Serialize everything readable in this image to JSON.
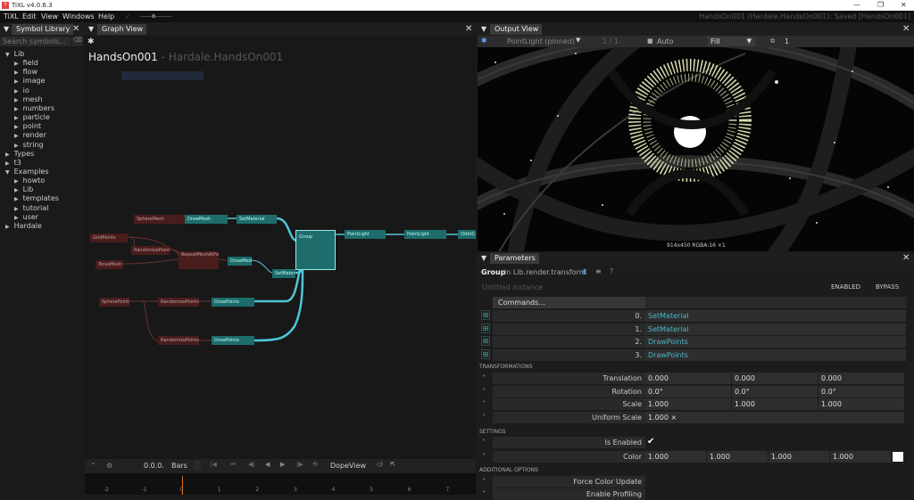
{
  "window": {
    "title": "TiXL v4.0.6.3",
    "logo": "T",
    "min": "—",
    "max": "❐",
    "close": "✕"
  },
  "menu": {
    "items": [
      "TiXL",
      "Edit",
      "View",
      "Windows",
      "Help"
    ],
    "status": "HandsOn001 (Hardale.HandsOn001): Saved [HandsOn001]"
  },
  "symbol_library": {
    "tab": "Symbol Library",
    "search_placeholder": "Search symbols...",
    "tree": [
      {
        "label": "Lib",
        "level": 0,
        "open": true
      },
      {
        "label": "field",
        "level": 1
      },
      {
        "label": "flow",
        "level": 1
      },
      {
        "label": "image",
        "level": 1
      },
      {
        "label": "io",
        "level": 1
      },
      {
        "label": "mesh",
        "level": 1
      },
      {
        "label": "numbers",
        "level": 1
      },
      {
        "label": "particle",
        "level": 1
      },
      {
        "label": "point",
        "level": 1
      },
      {
        "label": "render",
        "level": 1
      },
      {
        "label": "string",
        "level": 1
      },
      {
        "label": "Types",
        "level": 0
      },
      {
        "label": "t3",
        "level": 0
      },
      {
        "label": "Examples",
        "level": 0,
        "open": true
      },
      {
        "label": "howto",
        "level": 1
      },
      {
        "label": "Lib",
        "level": 1
      },
      {
        "label": "templates",
        "level": 1
      },
      {
        "label": "tutorial",
        "level": 1
      },
      {
        "label": "user",
        "level": 1
      },
      {
        "label": "Hardale",
        "level": 0
      }
    ]
  },
  "graph": {
    "tab": "Graph View",
    "title": "HandsOn001",
    "subtitle": " - Hardale.HandsOn001",
    "nodes": {
      "spheremesh": "SphereMesh",
      "drawmesh": "DrawMesh",
      "setmaterial1": "SetMaterial",
      "gridpoints": "GridPoints",
      "randomizepoints": "RandomizePoints",
      "repeatmesh": "RepeatMeshAtPoints",
      "torusmesh": "TorusMesh",
      "drawmesh2": "DrawMesh",
      "setmaterial2": "SetMaterial",
      "spherepoints": "SpherePoints",
      "randomizeparts1": "RandomizePoints",
      "drawpoints1": "DrawPoints",
      "randomizeparts2": "RandomizePoints",
      "drawpoints2": "DrawPoints",
      "group": "Group",
      "pointlight1": "PointLight",
      "pointlight2": "PointLight",
      "orbitcam": "OrbitCam"
    }
  },
  "timeline": {
    "time": "0.0.0.",
    "unit": "Bars",
    "mode": "DopeView",
    "ticks": [
      "-2",
      "-1",
      "0",
      "1",
      "2",
      "3",
      "4",
      "5",
      "6",
      "7"
    ]
  },
  "output": {
    "tab": "Output View",
    "pinned": "PointLight (pinned)",
    "fraction": "1 / 1",
    "fill_mode": "Auto",
    "scale": "Fill",
    "count": "1",
    "resolution": "914x450  RGBA:16  ×1"
  },
  "params": {
    "tab": "Parameters",
    "op": "Group",
    "path": "in Lib.render.transform",
    "instance": "Untitled instance",
    "enabled": "ENABLED",
    "bypass": "BYPASS",
    "commands_label": "Commands...",
    "commands": [
      {
        "idx": "0.",
        "name": "SetMaterial"
      },
      {
        "idx": "1.",
        "name": "SetMaterial"
      },
      {
        "idx": "2.",
        "name": "DrawPoints"
      },
      {
        "idx": "3.",
        "name": "DrawPoints"
      }
    ],
    "sect_transform": "TRANSFORMATIONS",
    "translation": {
      "label": "Translation",
      "v": [
        "0.000",
        "0.000",
        "0.000"
      ]
    },
    "rotation": {
      "label": "Rotation",
      "v": [
        "0.0°",
        "0.0°",
        "0.0°"
      ]
    },
    "scale": {
      "label": "Scale",
      "v": [
        "1.000",
        "1.000",
        "1.000"
      ]
    },
    "uniform": {
      "label": "Uniform Scale",
      "v": "1.000 ×"
    },
    "sect_settings": "SETTINGS",
    "enabled_row": {
      "label": "Is Enabled",
      "check": "✔"
    },
    "color": {
      "label": "Color",
      "v": [
        "1.000",
        "1.000",
        "1.000",
        "1.000"
      ]
    },
    "sect_additional": "ADDITIONAL OPTIONS",
    "force": "Force Color Update",
    "profiling": "Enable Profiling"
  },
  "colors": {
    "accent": "#2a9d9d",
    "node_red": "#4a1d1d",
    "node_teal": "#1e6c6c",
    "link": "#4dc6d6"
  }
}
